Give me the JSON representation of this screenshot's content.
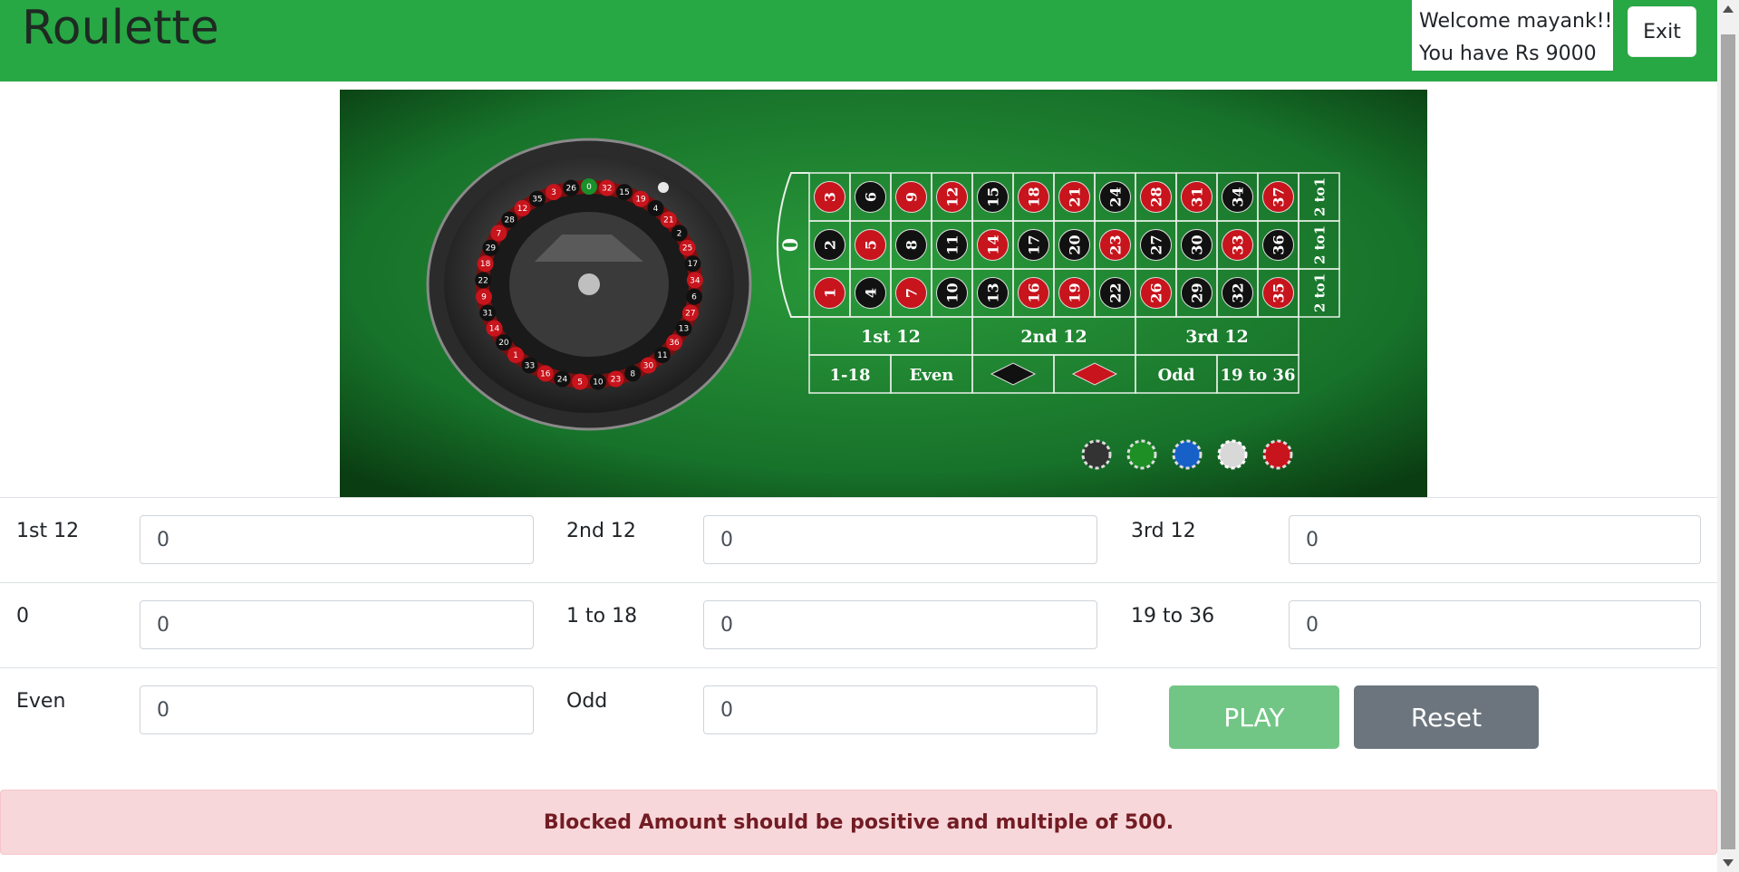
{
  "header": {
    "brand": "Roulette",
    "welcome_line1": "Welcome mayank!!",
    "welcome_line2": "You have Rs 9000",
    "exit_label": "Exit"
  },
  "board": {
    "zero": "0",
    "numbers_top": [
      "3",
      "6",
      "9",
      "12",
      "15",
      "18",
      "21",
      "24",
      "28",
      "31",
      "34",
      "37"
    ],
    "numbers_mid": [
      "2",
      "5",
      "8",
      "11",
      "14",
      "17",
      "20",
      "23",
      "27",
      "30",
      "33",
      "36"
    ],
    "numbers_bot": [
      "1",
      "4",
      "7",
      "10",
      "13",
      "16",
      "19",
      "22",
      "26",
      "29",
      "32",
      "35"
    ],
    "column_bet": "2 to1",
    "dozens": [
      "1st 12",
      "2nd 12",
      "3rd 12"
    ],
    "outside": [
      "1-18",
      "Even",
      "Odd",
      "19 to 36"
    ],
    "colors": {
      "felt": "#1e7d2c",
      "red": "#c8141c",
      "black": "#111111",
      "green": "#1a8f2a",
      "line": "#e8f0e8"
    }
  },
  "bets": {
    "first12_label": "1st 12",
    "first12_value": "0",
    "second12_label": "2nd 12",
    "second12_value": "0",
    "third12_label": "3rd 12",
    "third12_value": "0",
    "zero_label": "0",
    "zero_value": "0",
    "low_label": "1 to 18",
    "low_value": "0",
    "high_label": "19 to 36",
    "high_value": "0",
    "even_label": "Even",
    "even_value": "0",
    "odd_label": "Odd",
    "odd_value": "0"
  },
  "actions": {
    "play_label": "PLAY",
    "reset_label": "Reset"
  },
  "alert": {
    "message": "Blocked Amount should be positive and multiple of 500."
  }
}
